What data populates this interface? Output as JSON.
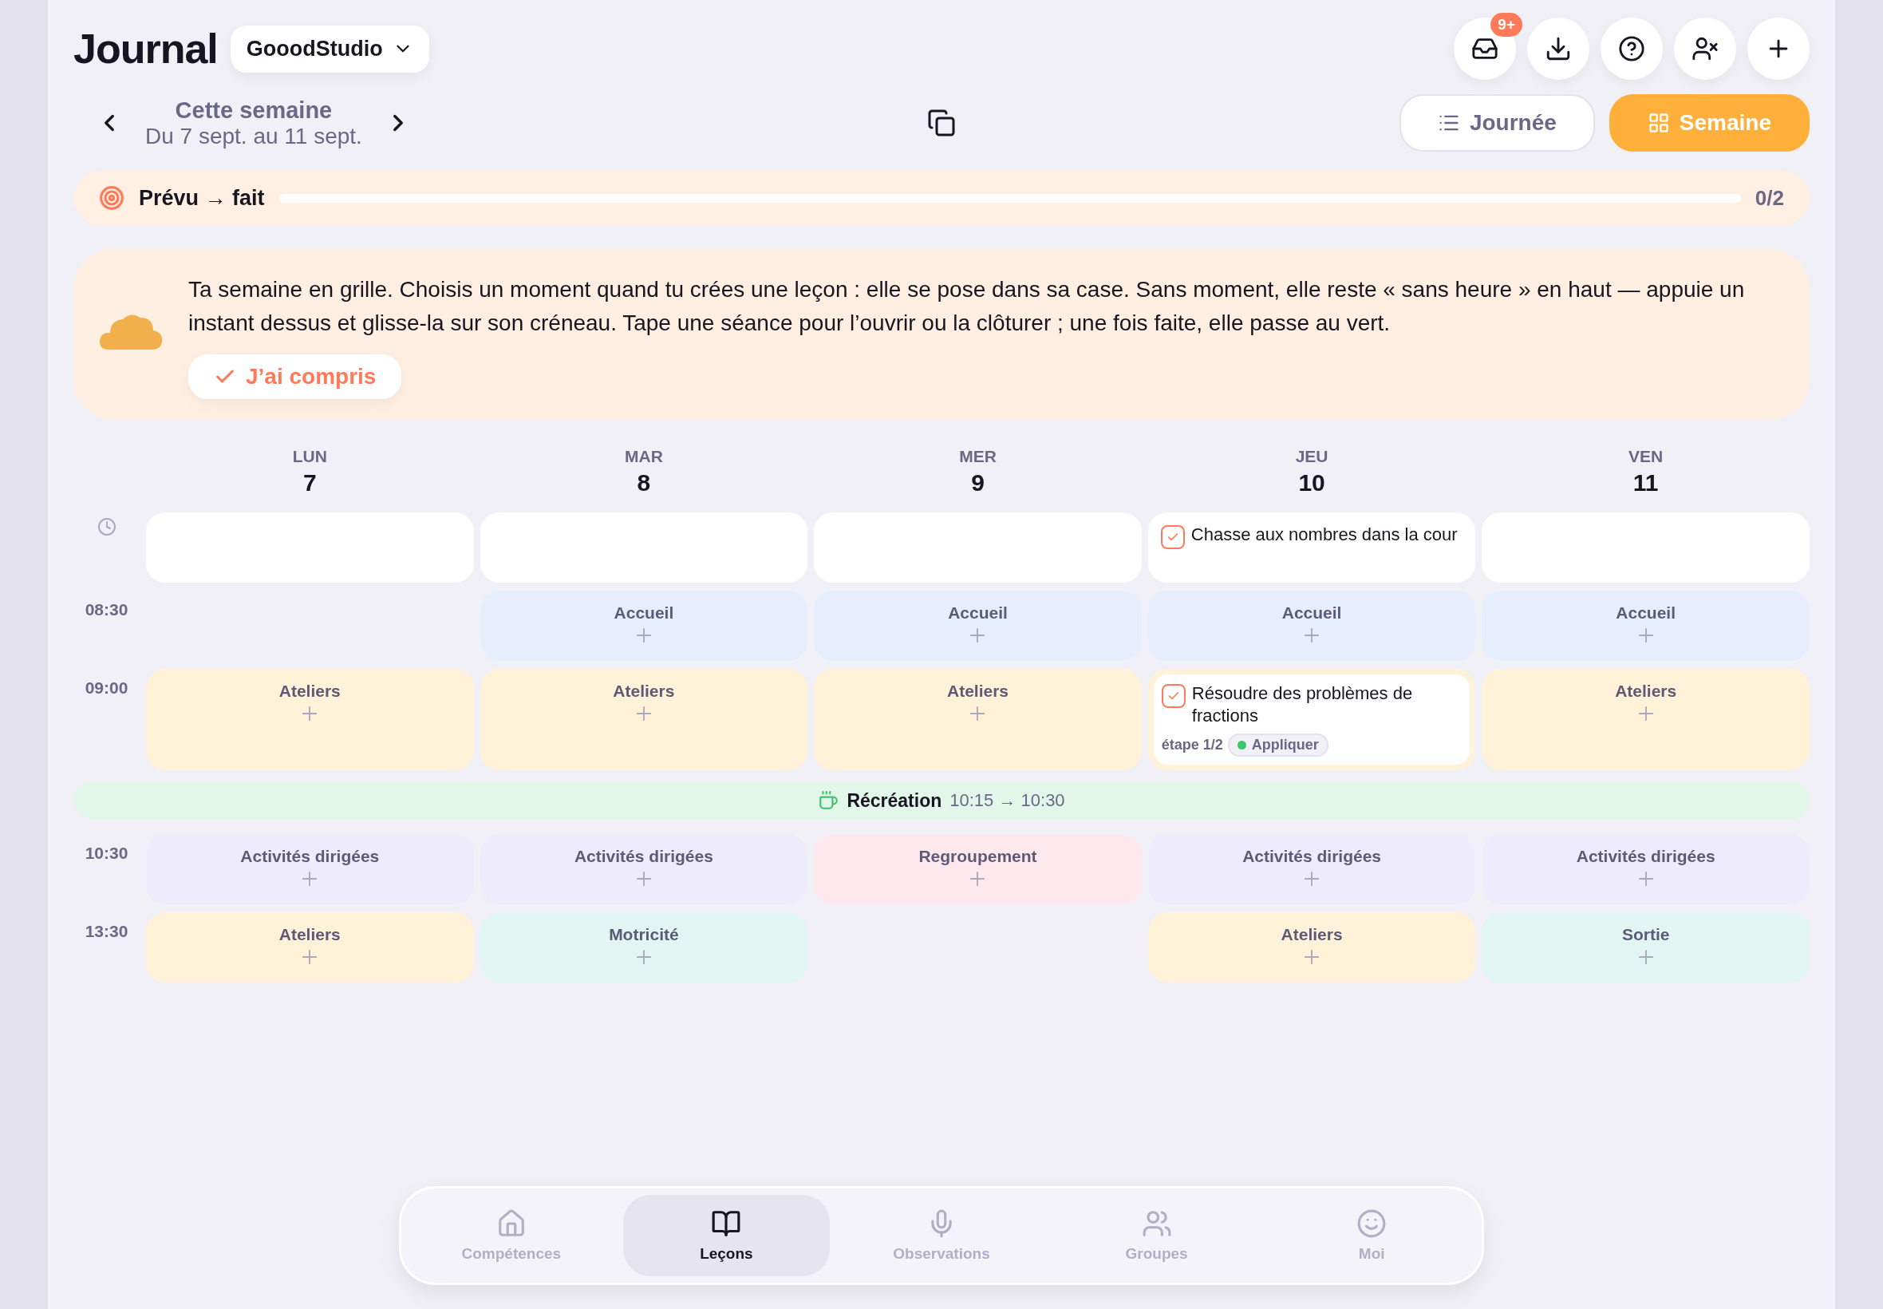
{
  "header": {
    "title": "Journal",
    "workspace": "GooodStudio",
    "actions": [
      {
        "kind": "inbox",
        "badge": "9+"
      },
      {
        "kind": "download"
      },
      {
        "kind": "help"
      },
      {
        "kind": "remove-user"
      },
      {
        "kind": "add"
      }
    ]
  },
  "week": {
    "label": "Cette semaine",
    "range": "Du 7 sept. au 11 sept."
  },
  "views": [
    {
      "kind": "list",
      "label": "Journée",
      "selected": false
    },
    {
      "kind": "grid",
      "label": "Semaine",
      "selected": true
    }
  ],
  "progress": {
    "label": "Prévu → fait",
    "level": 0,
    "reading": "0/2"
  },
  "tip": {
    "text": "Ta semaine en grille. Choisis un moment quand tu crées une leçon : elle se pose dans sa case. Sans moment, elle reste « sans heure » en haut — appuie un instant dessus et glisse-la sur son créneau. Tape une séance pour l’ouvrir ou la clôturer ; une fois faite, elle passe au vert.",
    "button": "J’ai compris"
  },
  "days": [
    {
      "name": "LUN",
      "number": "7"
    },
    {
      "name": "MAR",
      "number": "8"
    },
    {
      "name": "MER",
      "number": "9"
    },
    {
      "name": "JEU",
      "number": "10"
    },
    {
      "name": "VEN",
      "number": "11"
    }
  ],
  "untimed": [
    {
      "kind": "empty"
    },
    {
      "kind": "empty"
    },
    {
      "kind": "empty"
    },
    {
      "kind": "lesson",
      "title": "Chasse aux nombres dans la cour",
      "checked": true
    },
    {
      "kind": "empty"
    }
  ],
  "rows": [
    {
      "kind": "slots",
      "time": "08:30",
      "slots": [
        {
          "kind": "none"
        },
        {
          "kind": "slot",
          "label": "Accueil",
          "color": "#e6eefd"
        },
        {
          "kind": "slot",
          "label": "Accueil",
          "color": "#e6eefd"
        },
        {
          "kind": "slot",
          "label": "Accueil",
          "color": "#e6eefd"
        },
        {
          "kind": "slot",
          "label": "Accueil",
          "color": "#e6eefd"
        }
      ]
    },
    {
      "kind": "slots",
      "time": "09:00",
      "slots": [
        {
          "kind": "slot",
          "label": "Ateliers",
          "color": "#fff2d9"
        },
        {
          "kind": "slot",
          "label": "Ateliers",
          "color": "#fff2d9"
        },
        {
          "kind": "slot",
          "label": "Ateliers",
          "color": "#fff2d9"
        },
        {
          "kind": "lesson",
          "color": "#fff2d9",
          "title": "Résoudre des problèmes de fractions",
          "checked": true,
          "step": "étape 1/2",
          "tag": {
            "label": "Appliquer",
            "color": "#3cc46a"
          }
        },
        {
          "kind": "slot",
          "label": "Ateliers",
          "color": "#fff2d9"
        }
      ]
    },
    {
      "kind": "break",
      "label": "Récréation",
      "time": "10:15 → 10:30"
    },
    {
      "kind": "slots",
      "time": "10:30",
      "slots": [
        {
          "kind": "slot",
          "label": "Activités dirigées",
          "color": "#eeebfd"
        },
        {
          "kind": "slot",
          "label": "Activités dirigées",
          "color": "#eeebfd"
        },
        {
          "kind": "slot",
          "label": "Regroupement",
          "color": "#fde8ee"
        },
        {
          "kind": "slot",
          "label": "Activités dirigées",
          "color": "#eeebfd"
        },
        {
          "kind": "slot",
          "label": "Activités dirigées",
          "color": "#eeebfd"
        }
      ]
    },
    {
      "kind": "slots",
      "time": "13:30",
      "slots": [
        {
          "kind": "slot",
          "label": "Ateliers",
          "color": "#fff2d9"
        },
        {
          "kind": "slot",
          "label": "Motricité",
          "color": "#e1f6f2"
        },
        {
          "kind": "none"
        },
        {
          "kind": "slot",
          "label": "Ateliers",
          "color": "#fff2d9"
        },
        {
          "kind": "slot",
          "label": "Sortie",
          "color": "#e1f6f2"
        }
      ]
    }
  ],
  "nav": [
    {
      "kind": "home",
      "label": "Compétences",
      "selected": false
    },
    {
      "kind": "book",
      "label": "Leçons",
      "selected": true
    },
    {
      "kind": "mic",
      "label": "Observations",
      "selected": false
    },
    {
      "kind": "users",
      "label": "Groupes",
      "selected": false
    },
    {
      "kind": "smile",
      "label": "Moi",
      "selected": false
    }
  ]
}
